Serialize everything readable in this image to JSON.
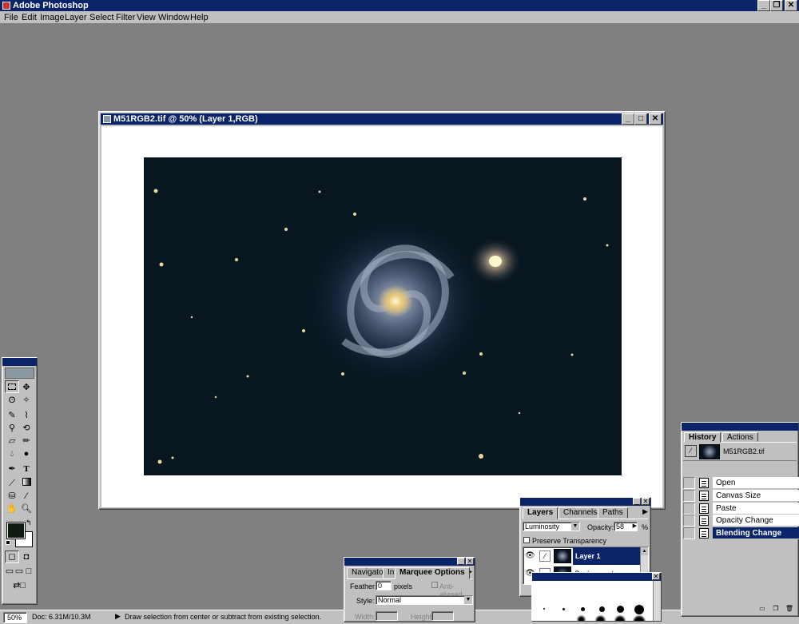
{
  "app": {
    "title": "Adobe Photoshop"
  },
  "menu": [
    "File",
    "Edit",
    "Image",
    "Layer",
    "Select",
    "Filter",
    "View",
    "Window",
    "Help"
  ],
  "document": {
    "title": "M51RGB2.tif @ 50% (Layer 1,RGB)"
  },
  "status": {
    "zoom": "50%",
    "doc_size": "Doc: 6.31M/10.3M",
    "hint": "Draw selection from center or subtract from existing selection."
  },
  "navigator_panel": {
    "tabs": [
      "Navigator",
      "Inf",
      "Marquee Options"
    ],
    "feather_label": "Feather:",
    "feather_value": "0",
    "feather_unit": "pixels",
    "anti_aliased": "Anti-aliased",
    "style_label": "Style:",
    "style_value": "Normal",
    "width_label": "Width:",
    "height_label": "Height:"
  },
  "layers_panel": {
    "tabs": [
      "Layers",
      "Channels",
      "Paths"
    ],
    "blend_mode": "Luminosity",
    "opacity_label": "Opacity:",
    "opacity_value": "58",
    "opacity_unit": "%",
    "preserve_transparency": "Preserve Transparency",
    "layers": [
      {
        "name": "Layer 1",
        "selected": true
      },
      {
        "name": "Background",
        "selected": false
      }
    ]
  },
  "history_panel": {
    "tabs": [
      "History",
      "Actions"
    ],
    "snapshot": "M51RGB2.tif",
    "items": [
      "Open",
      "Canvas Size",
      "Paste",
      "Opacity Change",
      "Blending Change"
    ],
    "selected_index": 4
  },
  "colors": {
    "titlebar": "#0a246a",
    "workspace": "#808080",
    "chrome": "#c0c0c0",
    "space": "#081620"
  },
  "icons": [
    "app-icon",
    "minimize-icon",
    "maximize-icon",
    "close-icon",
    "eye-icon",
    "brush-icon",
    "trash-icon",
    "new-layer-icon"
  ]
}
